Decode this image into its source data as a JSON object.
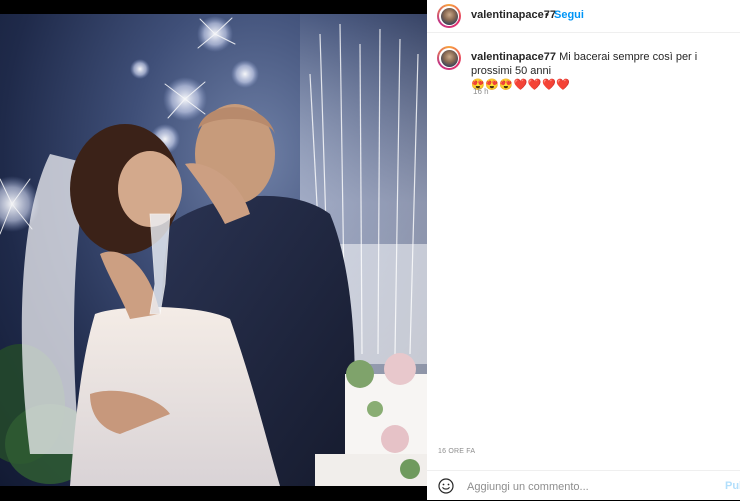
{
  "post": {
    "username": "valentinapace77",
    "separator": "•",
    "follow_label": "Segui",
    "caption_user": "valentinapace77",
    "caption": "Mi bacerai sempre così per i prossimi 50 anni",
    "caption_emojis": "😍😍😍❤️❤️❤️❤️",
    "comment_age": "16 h",
    "posted_ago": "16 ORE FA"
  },
  "comment_box": {
    "placeholder": "Aggiungi un commento...",
    "post_label": "Pubblica"
  },
  "image": {
    "subject": "wedding-kiss-with-sparklers"
  },
  "colors": {
    "follow": "#0095f6",
    "muted": "#8e8e8e",
    "text": "#262626"
  }
}
